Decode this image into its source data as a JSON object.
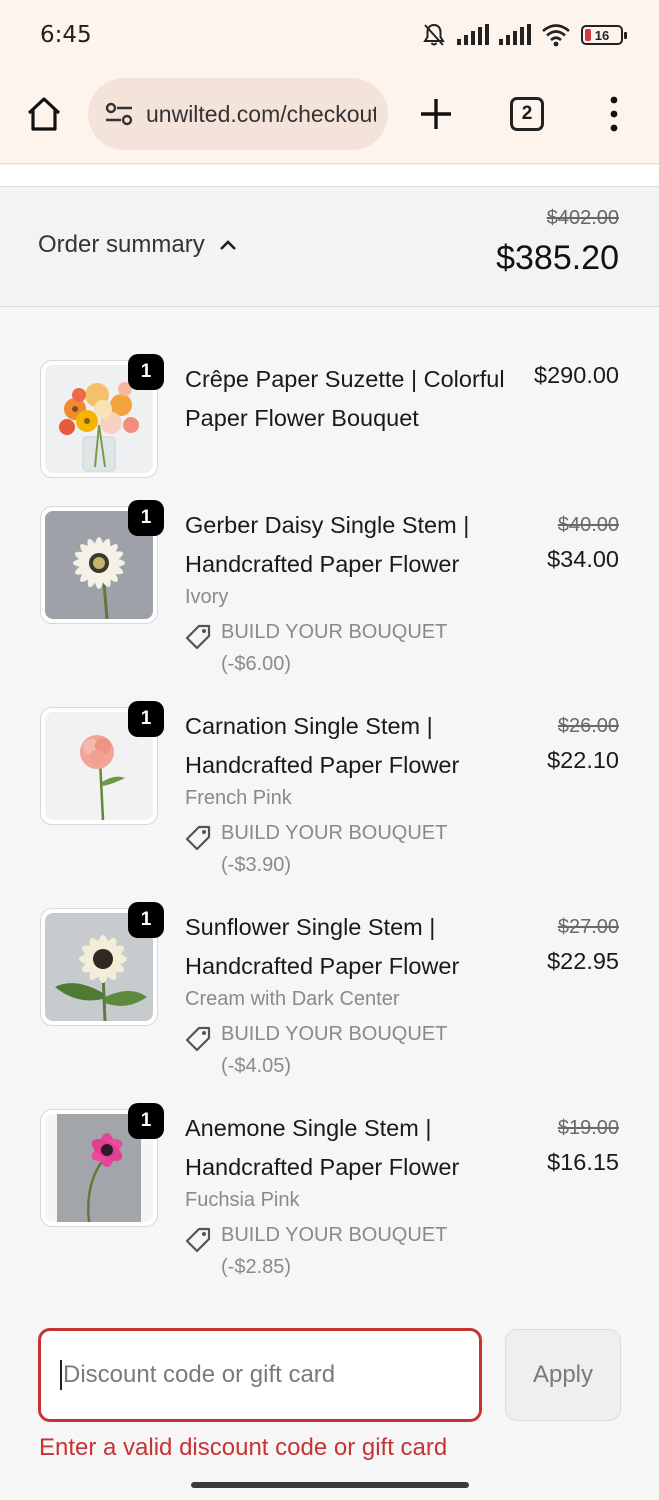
{
  "status_bar": {
    "time": "6:45",
    "battery": "16"
  },
  "browser": {
    "url": "unwilted.com/checkout",
    "tab_count": "2"
  },
  "summary": {
    "label": "Order summary",
    "original_total": "$402.00",
    "total": "$385.20"
  },
  "items": [
    {
      "qty": "1",
      "title": "Crêpe Paper Suzette | Colorful Paper Flower Bouquet",
      "price": "$290.00"
    },
    {
      "qty": "1",
      "title": "Gerber Daisy Single Stem | Handcrafted Paper Flower",
      "variant": "Ivory",
      "discount": "BUILD YOUR BOUQUET (-$6.00)",
      "original_price": "$40.00",
      "price": "$34.00"
    },
    {
      "qty": "1",
      "title": "Carnation Single Stem | Handcrafted Paper Flower",
      "variant": "French Pink",
      "discount": "BUILD YOUR BOUQUET (-$3.90)",
      "original_price": "$26.00",
      "price": "$22.10"
    },
    {
      "qty": "1",
      "title": "Sunflower Single Stem | Handcrafted Paper Flower",
      "variant": "Cream with Dark Center",
      "discount": "BUILD YOUR BOUQUET (-$4.05)",
      "original_price": "$27.00",
      "price": "$22.95"
    },
    {
      "qty": "1",
      "title": "Anemone Single Stem | Handcrafted Paper Flower",
      "variant": "Fuchsia Pink",
      "discount": "BUILD YOUR BOUQUET (-$2.85)",
      "original_price": "$19.00",
      "price": "$16.15"
    }
  ],
  "discount_form": {
    "placeholder": "Discount code or gift card",
    "apply_label": "Apply",
    "error": "Enter a valid discount code or gift card"
  },
  "colors": {
    "error": "#c73333",
    "browser_chrome": "#fdf4ee",
    "url_pill": "#f4e3d9"
  },
  "icons": [
    "bell-muted-icon",
    "signal-icon",
    "wifi-icon",
    "battery-icon",
    "home-icon",
    "site-settings-icon",
    "plus-icon",
    "tabs-icon",
    "more-vert-icon",
    "chevron-up-icon",
    "tag-icon"
  ]
}
